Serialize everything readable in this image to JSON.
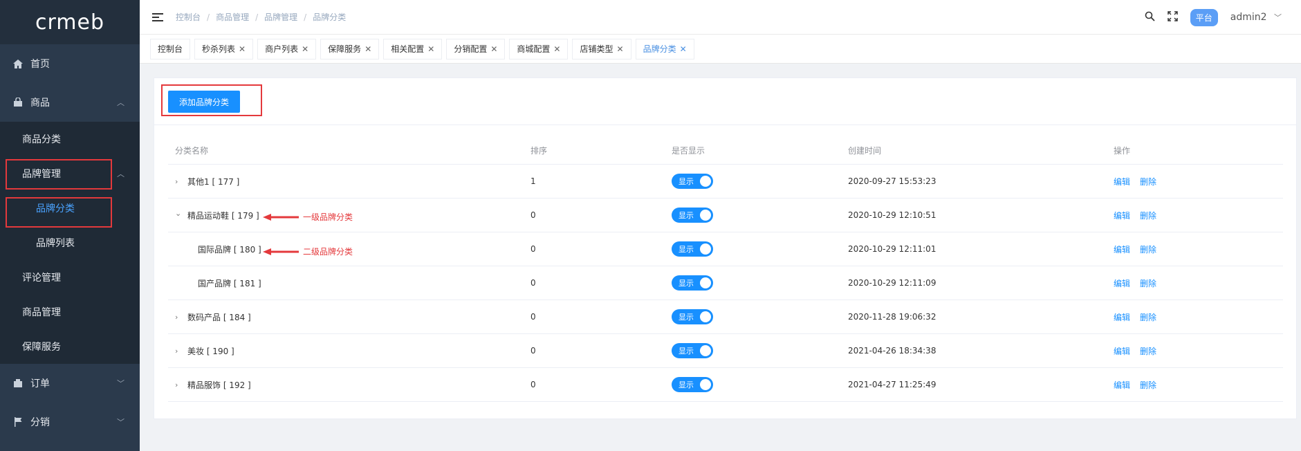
{
  "logo": {
    "text": "crmeb"
  },
  "sidebar": {
    "home": "首页",
    "product": "商品",
    "product_sub": {
      "category": "商品分类",
      "brand_mgmt": "品牌管理",
      "brand_category": "品牌分类",
      "brand_list": "品牌列表",
      "reviews": "评论管理",
      "product_mgmt": "商品管理",
      "guarantee": "保障服务"
    },
    "orders": "订单",
    "distribution": "分销"
  },
  "header": {
    "breadcrumb": [
      "控制台",
      "商品管理",
      "品牌管理",
      "品牌分类"
    ],
    "platform_badge": "平台",
    "username": "admin2"
  },
  "tabs": [
    {
      "label": "控制台",
      "closable": false
    },
    {
      "label": "秒杀列表",
      "closable": true
    },
    {
      "label": "商户列表",
      "closable": true
    },
    {
      "label": "保障服务",
      "closable": true
    },
    {
      "label": "相关配置",
      "closable": true
    },
    {
      "label": "分销配置",
      "closable": true
    },
    {
      "label": "商城配置",
      "closable": true
    },
    {
      "label": "店铺类型",
      "closable": true
    },
    {
      "label": "品牌分类",
      "closable": true,
      "active": true
    }
  ],
  "toolbar": {
    "add_label": "添加品牌分类"
  },
  "table": {
    "columns": [
      "分类名称",
      "排序",
      "是否显示",
      "创建时间",
      "操作"
    ],
    "rows": [
      {
        "name": "其他1 [ 177 ]",
        "sort": "1",
        "show": "显示",
        "created": "2020-09-27 15:53:23",
        "level": 1,
        "expand": "collapsed"
      },
      {
        "name": "精品运动鞋 [ 179 ]",
        "sort": "0",
        "show": "显示",
        "created": "2020-10-29 12:10:51",
        "level": 1,
        "expand": "expanded"
      },
      {
        "name": "国际品牌 [ 180 ]",
        "sort": "0",
        "show": "显示",
        "created": "2020-10-29 12:11:01",
        "level": 2,
        "expand": "none"
      },
      {
        "name": "国产品牌 [ 181 ]",
        "sort": "0",
        "show": "显示",
        "created": "2020-10-29 12:11:09",
        "level": 2,
        "expand": "none"
      },
      {
        "name": "数码产品 [ 184 ]",
        "sort": "0",
        "show": "显示",
        "created": "2020-11-28 19:06:32",
        "level": 1,
        "expand": "collapsed"
      },
      {
        "name": "美妆 [ 190 ]",
        "sort": "0",
        "show": "显示",
        "created": "2021-04-26 18:34:38",
        "level": 1,
        "expand": "collapsed"
      },
      {
        "name": "精品服饰 [ 192 ]",
        "sort": "0",
        "show": "显示",
        "created": "2021-04-27 11:25:49",
        "level": 1,
        "expand": "collapsed"
      }
    ],
    "actions": {
      "edit": "编辑",
      "delete": "删除"
    }
  },
  "annotations": {
    "level1": "一级品牌分类",
    "level2": "二级品牌分类"
  },
  "colors": {
    "primary": "#1890ff",
    "sidebar": "#2b3a4c",
    "highlight": "#e4393c"
  }
}
